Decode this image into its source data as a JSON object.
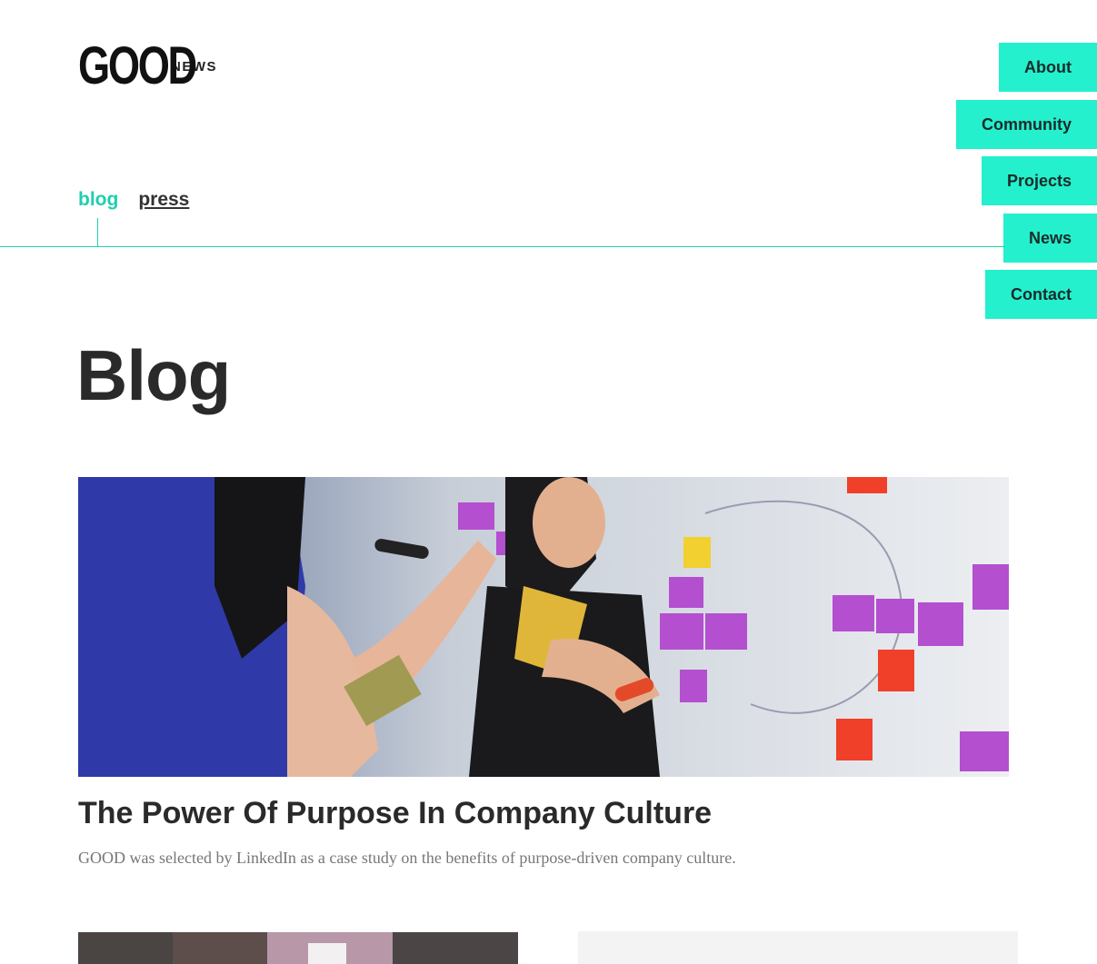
{
  "header": {
    "logo_text": "GOOD",
    "section_label": "NEWS"
  },
  "nav": {
    "items": [
      {
        "label": "About"
      },
      {
        "label": "Community"
      },
      {
        "label": "Projects"
      },
      {
        "label": "News"
      },
      {
        "label": "Contact"
      }
    ],
    "accent_color": "#24f0cd"
  },
  "subnav": {
    "blog_label": "blog",
    "press_label": "press",
    "active": "blog",
    "active_color": "#1fcfae"
  },
  "main": {
    "title": "Blog",
    "featured_post": {
      "title": "The Power Of Purpose In Company Culture",
      "excerpt": "GOOD was selected by LinkedIn as a case study on the benefits of purpose-driven company culture."
    }
  }
}
